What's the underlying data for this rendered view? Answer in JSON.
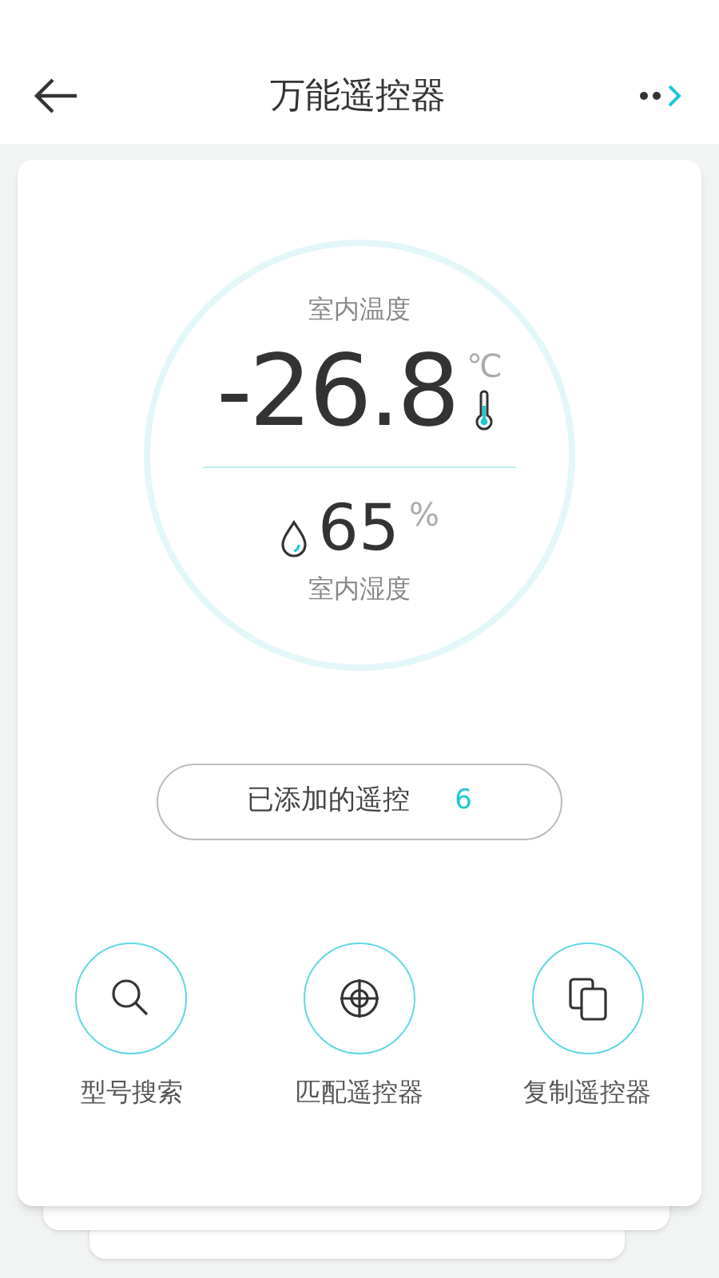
{
  "header": {
    "title": "万能遥控器"
  },
  "climate": {
    "temperature_label": "室内温度",
    "temperature": "-26.8",
    "temperature_unit": "℃",
    "humidity": "65",
    "humidity_unit": "%",
    "humidity_label": "室内湿度"
  },
  "added_remotes": {
    "label": "已添加的遥控",
    "count": "6"
  },
  "actions": [
    {
      "kind": "search",
      "label": "型号搜索"
    },
    {
      "kind": "match",
      "label": "匹配遥控器"
    },
    {
      "kind": "copy",
      "label": "复制遥控器"
    }
  ]
}
